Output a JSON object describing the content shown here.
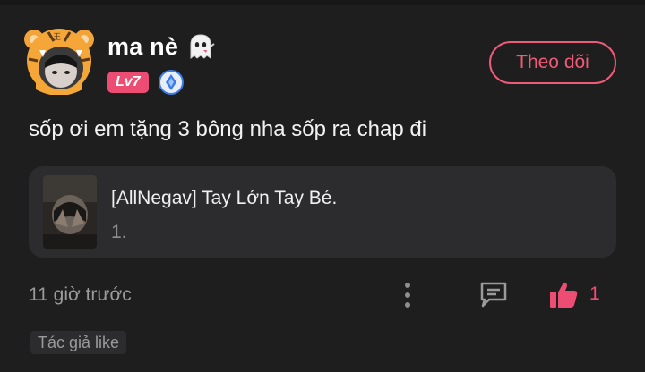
{
  "user": {
    "name": "ma nè",
    "level": "Lv7",
    "avatar_icon": "tiger-hood-avatar",
    "name_emoji_icon": "ghost-icon",
    "verify_icon": "blue-diamond-badge-icon"
  },
  "follow_button": {
    "label": "Theo dõi"
  },
  "comment": {
    "text": "sốp ơi em tặng 3 bông nha sốp ra chap đi"
  },
  "manga_card": {
    "title": "[AllNegav] Tay Lớn Tay Bé.",
    "chapter": "1."
  },
  "meta": {
    "timestamp": "11 giờ trước",
    "like_count": "1",
    "author_like_tag": "Tác giả like"
  },
  "colors": {
    "background": "#1e1e1e",
    "accent": "#ee4d73",
    "card": "#2c2c2e",
    "muted_text": "#9a9a9a"
  }
}
